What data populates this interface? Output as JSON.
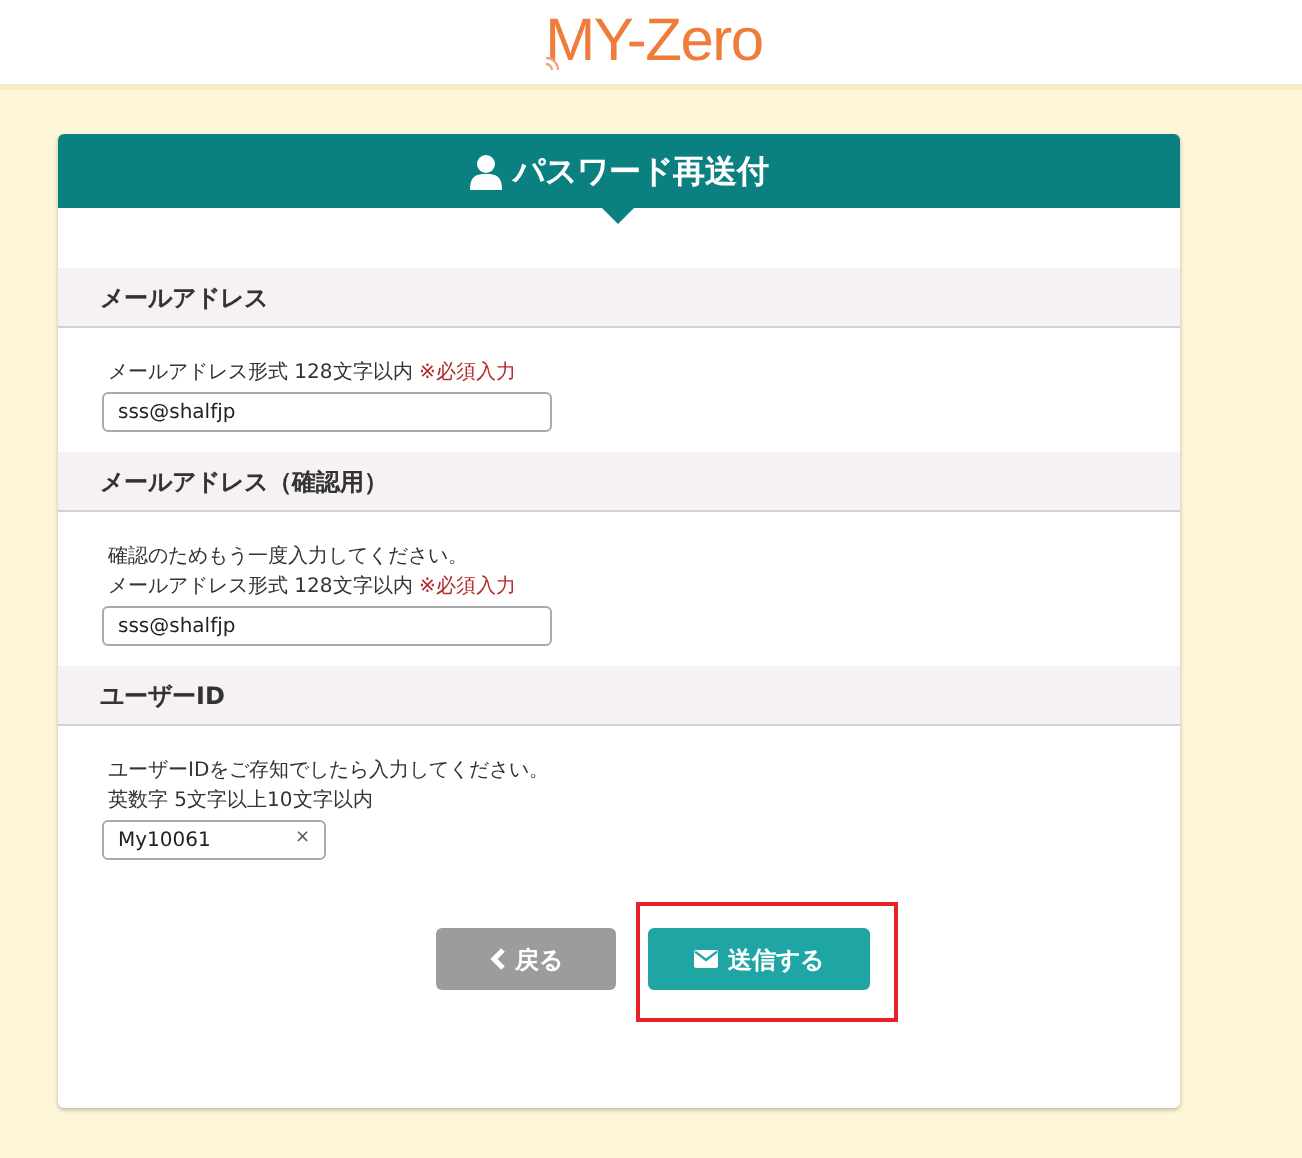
{
  "logo": {
    "text": "MY-Zero"
  },
  "panel": {
    "title": "パスワード再送付"
  },
  "sections": [
    {
      "heading": "メールアドレス",
      "notes": [
        {
          "text": "メールアドレス形式 128文字以内",
          "required": "※必須入力"
        }
      ],
      "field": {
        "value": "sss@shalfjp"
      }
    },
    {
      "heading": "メールアドレス（確認用）",
      "notes": [
        {
          "text": "確認のためもう一度入力してください。"
        },
        {
          "text": "メールアドレス形式 128文字以内",
          "required": "※必須入力"
        }
      ],
      "field": {
        "value": "sss@shalfjp"
      }
    },
    {
      "heading": "ユーザーID",
      "notes": [
        {
          "text": "ユーザーIDをご存知でしたら入力してください。"
        },
        {
          "text": "英数字 5文字以上10文字以内"
        }
      ],
      "field": {
        "value": "My10061",
        "clear": "×"
      }
    }
  ],
  "buttons": [
    {
      "label": "戻る",
      "kind": "back",
      "highlighted": false
    },
    {
      "label": "送信する",
      "kind": "submit",
      "highlighted": true
    }
  ]
}
